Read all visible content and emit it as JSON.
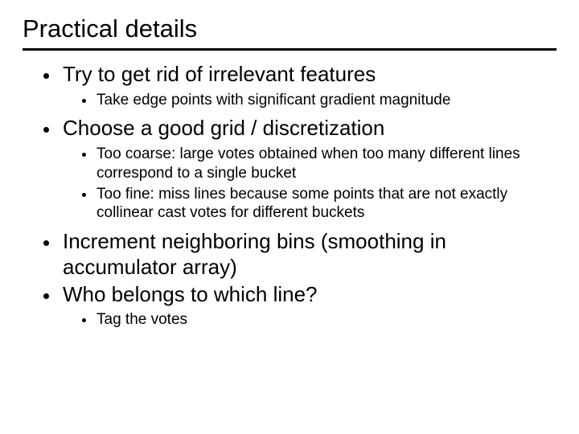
{
  "title": "Practical details",
  "bullets": {
    "b0": {
      "text": "Try to get rid of irrelevant features",
      "sub": {
        "s0": "Take edge points with significant gradient magnitude"
      }
    },
    "b1": {
      "text": "Choose a good grid / discretization",
      "sub": {
        "s0": "Too coarse: large votes obtained when too many different lines correspond to a single bucket",
        "s1": "Too fine: miss lines because some points that are not exactly collinear cast votes for different buckets"
      }
    },
    "b2": {
      "text": "Increment neighboring bins (smoothing in accumulator array)"
    },
    "b3": {
      "text": "Who belongs to which line?",
      "sub": {
        "s0": "Tag the votes"
      }
    }
  }
}
